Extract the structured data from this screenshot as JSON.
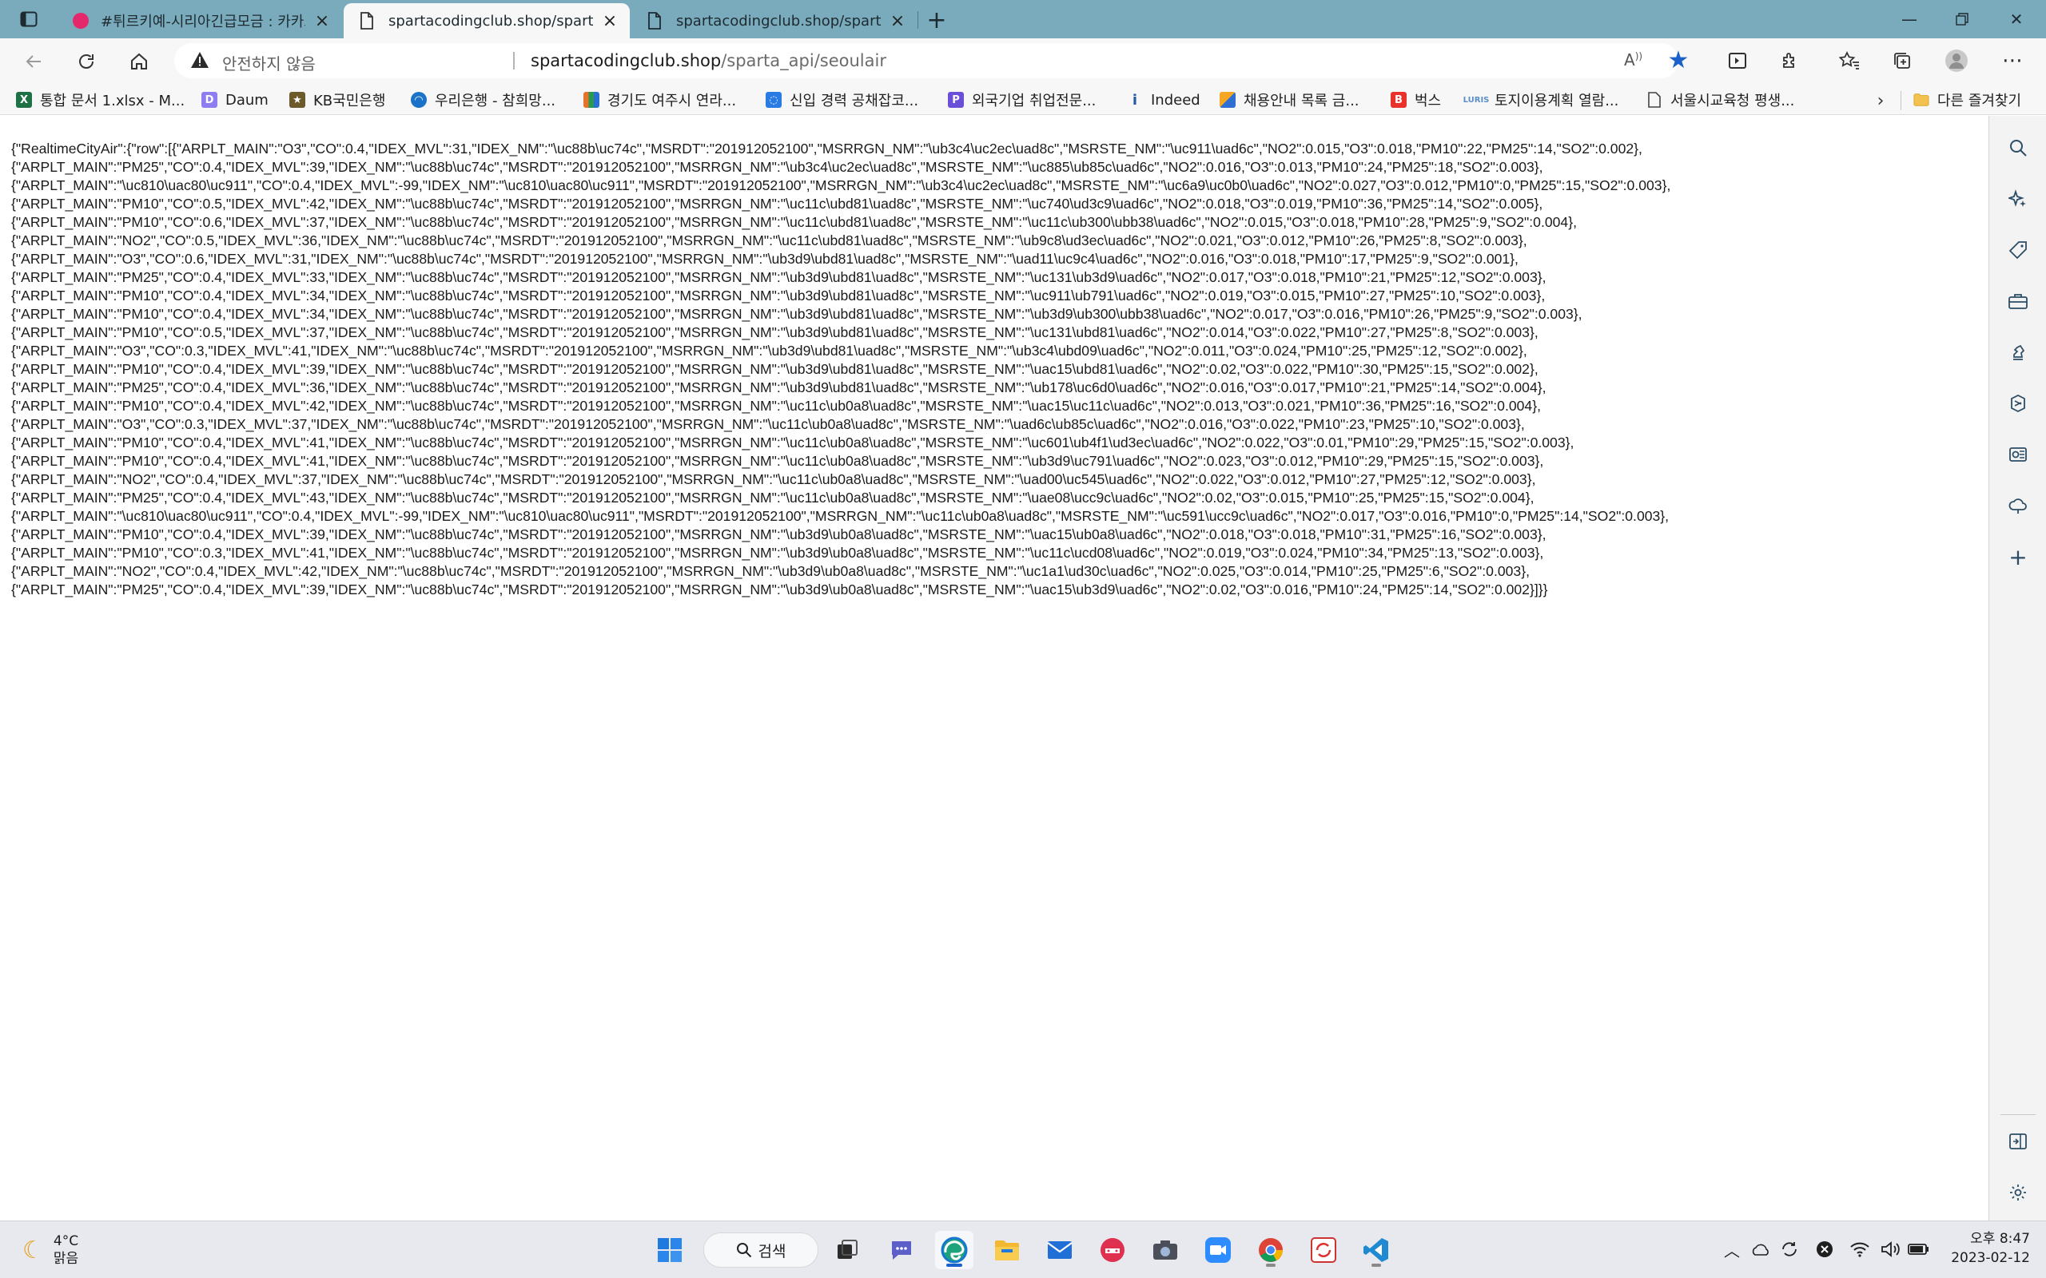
{
  "tabs": [
    {
      "title": "#튀르키예-시리아긴급모금 : 카카오",
      "active": false
    },
    {
      "title": "spartacodingclub.shop/sparta_api/seoulair",
      "active": true
    },
    {
      "title": "spartacodingclub.shop/sparta_api/seoulair",
      "active": false
    }
  ],
  "address": {
    "security_label": "안전하지 않음",
    "url_host": "spartacodingclub.shop",
    "url_path": "/sparta_api/seoulair"
  },
  "favorites": [
    {
      "label": "통합 문서 1.xlsx - M...",
      "icon": "excel-icon",
      "color": "#1e7145"
    },
    {
      "label": "Daum",
      "icon": "daum-icon",
      "color": "#7b68ee"
    },
    {
      "label": "KB국민은행",
      "icon": "kb-icon",
      "color": "#6d5a2b"
    },
    {
      "label": "우리은행 - 참희망...",
      "icon": "woori-icon",
      "color": "#1a72c9"
    },
    {
      "label": "경기도 여주시 연라...",
      "icon": "gyeonggi-icon",
      "color": "#e6732a"
    },
    {
      "label": "신입 경력 공채잡코...",
      "icon": "jobkorea-icon",
      "color": "#2b7be4"
    },
    {
      "label": "외국기업 취업전문...",
      "icon": "peoplenjob-icon",
      "color": "#6b4fd8"
    },
    {
      "label": "Indeed",
      "icon": "indeed-icon",
      "color": "#2557a7"
    },
    {
      "label": "채용안내 목록 금...",
      "icon": "recruit-icon",
      "color": "#2f6fd1"
    },
    {
      "label": "벅스",
      "icon": "bugs-icon",
      "color": "#e8322b"
    },
    {
      "label": "토지이용계획 열람...",
      "icon": "luris-icon",
      "color": "#5a8fc7"
    },
    {
      "label": "서울시교육청 평생...",
      "icon": "document-icon",
      "color": "#555555"
    }
  ],
  "favorites_other": "다른 즐겨찾기",
  "json_lines": [
    "{\"RealtimeCityAir\":{\"row\":[{\"ARPLT_MAIN\":\"O3\",\"CO\":0.4,\"IDEX_MVL\":31,\"IDEX_NM\":\"\\uc88b\\uc74c\",\"MSRDT\":\"201912052100\",\"MSRRGN_NM\":\"\\ub3c4\\uc2ec\\uad8c\",\"MSRSTE_NM\":\"\\uc911\\uad6c\",\"NO2\":0.015,\"O3\":0.018,\"PM10\":22,\"PM25\":14,\"SO2\":0.002},",
    "{\"ARPLT_MAIN\":\"PM25\",\"CO\":0.4,\"IDEX_MVL\":39,\"IDEX_NM\":\"\\uc88b\\uc74c\",\"MSRDT\":\"201912052100\",\"MSRRGN_NM\":\"\\ub3c4\\uc2ec\\uad8c\",\"MSRSTE_NM\":\"\\uc885\\ub85c\\uad6c\",\"NO2\":0.016,\"O3\":0.013,\"PM10\":24,\"PM25\":18,\"SO2\":0.003},",
    "{\"ARPLT_MAIN\":\"\\uc810\\uac80\\uc911\",\"CO\":0.4,\"IDEX_MVL\":-99,\"IDEX_NM\":\"\\uc810\\uac80\\uc911\",\"MSRDT\":\"201912052100\",\"MSRRGN_NM\":\"\\ub3c4\\uc2ec\\uad8c\",\"MSRSTE_NM\":\"\\uc6a9\\uc0b0\\uad6c\",\"NO2\":0.027,\"O3\":0.012,\"PM10\":0,\"PM25\":15,\"SO2\":0.003},",
    "{\"ARPLT_MAIN\":\"PM10\",\"CO\":0.5,\"IDEX_MVL\":42,\"IDEX_NM\":\"\\uc88b\\uc74c\",\"MSRDT\":\"201912052100\",\"MSRRGN_NM\":\"\\uc11c\\ubd81\\uad8c\",\"MSRSTE_NM\":\"\\uc740\\ud3c9\\uad6c\",\"NO2\":0.018,\"O3\":0.019,\"PM10\":36,\"PM25\":14,\"SO2\":0.005},",
    "{\"ARPLT_MAIN\":\"PM10\",\"CO\":0.6,\"IDEX_MVL\":37,\"IDEX_NM\":\"\\uc88b\\uc74c\",\"MSRDT\":\"201912052100\",\"MSRRGN_NM\":\"\\uc11c\\ubd81\\uad8c\",\"MSRSTE_NM\":\"\\uc11c\\ub300\\ubb38\\uad6c\",\"NO2\":0.015,\"O3\":0.018,\"PM10\":28,\"PM25\":9,\"SO2\":0.004},",
    "{\"ARPLT_MAIN\":\"NO2\",\"CO\":0.5,\"IDEX_MVL\":36,\"IDEX_NM\":\"\\uc88b\\uc74c\",\"MSRDT\":\"201912052100\",\"MSRRGN_NM\":\"\\uc11c\\ubd81\\uad8c\",\"MSRSTE_NM\":\"\\ub9c8\\ud3ec\\uad6c\",\"NO2\":0.021,\"O3\":0.012,\"PM10\":26,\"PM25\":8,\"SO2\":0.003},",
    "{\"ARPLT_MAIN\":\"O3\",\"CO\":0.6,\"IDEX_MVL\":31,\"IDEX_NM\":\"\\uc88b\\uc74c\",\"MSRDT\":\"201912052100\",\"MSRRGN_NM\":\"\\ub3d9\\ubd81\\uad8c\",\"MSRSTE_NM\":\"\\uad11\\uc9c4\\uad6c\",\"NO2\":0.016,\"O3\":0.018,\"PM10\":17,\"PM25\":9,\"SO2\":0.001},",
    "{\"ARPLT_MAIN\":\"PM25\",\"CO\":0.4,\"IDEX_MVL\":33,\"IDEX_NM\":\"\\uc88b\\uc74c\",\"MSRDT\":\"201912052100\",\"MSRRGN_NM\":\"\\ub3d9\\ubd81\\uad8c\",\"MSRSTE_NM\":\"\\uc131\\ub3d9\\uad6c\",\"NO2\":0.017,\"O3\":0.018,\"PM10\":21,\"PM25\":12,\"SO2\":0.003},",
    "{\"ARPLT_MAIN\":\"PM10\",\"CO\":0.4,\"IDEX_MVL\":34,\"IDEX_NM\":\"\\uc88b\\uc74c\",\"MSRDT\":\"201912052100\",\"MSRRGN_NM\":\"\\ub3d9\\ubd81\\uad8c\",\"MSRSTE_NM\":\"\\uc911\\ub791\\uad6c\",\"NO2\":0.019,\"O3\":0.015,\"PM10\":27,\"PM25\":10,\"SO2\":0.003},",
    "{\"ARPLT_MAIN\":\"PM10\",\"CO\":0.4,\"IDEX_MVL\":34,\"IDEX_NM\":\"\\uc88b\\uc74c\",\"MSRDT\":\"201912052100\",\"MSRRGN_NM\":\"\\ub3d9\\ubd81\\uad8c\",\"MSRSTE_NM\":\"\\ub3d9\\ub300\\ubb38\\uad6c\",\"NO2\":0.017,\"O3\":0.016,\"PM10\":26,\"PM25\":9,\"SO2\":0.003},",
    "{\"ARPLT_MAIN\":\"PM10\",\"CO\":0.5,\"IDEX_MVL\":37,\"IDEX_NM\":\"\\uc88b\\uc74c\",\"MSRDT\":\"201912052100\",\"MSRRGN_NM\":\"\\ub3d9\\ubd81\\uad8c\",\"MSRSTE_NM\":\"\\uc131\\ubd81\\uad6c\",\"NO2\":0.014,\"O3\":0.022,\"PM10\":27,\"PM25\":8,\"SO2\":0.003},",
    "{\"ARPLT_MAIN\":\"O3\",\"CO\":0.3,\"IDEX_MVL\":41,\"IDEX_NM\":\"\\uc88b\\uc74c\",\"MSRDT\":\"201912052100\",\"MSRRGN_NM\":\"\\ub3d9\\ubd81\\uad8c\",\"MSRSTE_NM\":\"\\ub3c4\\ubd09\\uad6c\",\"NO2\":0.011,\"O3\":0.024,\"PM10\":25,\"PM25\":12,\"SO2\":0.002},",
    "{\"ARPLT_MAIN\":\"PM10\",\"CO\":0.4,\"IDEX_MVL\":39,\"IDEX_NM\":\"\\uc88b\\uc74c\",\"MSRDT\":\"201912052100\",\"MSRRGN_NM\":\"\\ub3d9\\ubd81\\uad8c\",\"MSRSTE_NM\":\"\\uac15\\ubd81\\uad6c\",\"NO2\":0.02,\"O3\":0.022,\"PM10\":30,\"PM25\":15,\"SO2\":0.002},",
    "{\"ARPLT_MAIN\":\"PM25\",\"CO\":0.4,\"IDEX_MVL\":36,\"IDEX_NM\":\"\\uc88b\\uc74c\",\"MSRDT\":\"201912052100\",\"MSRRGN_NM\":\"\\ub3d9\\ubd81\\uad8c\",\"MSRSTE_NM\":\"\\ub178\\uc6d0\\uad6c\",\"NO2\":0.016,\"O3\":0.017,\"PM10\":21,\"PM25\":14,\"SO2\":0.004},",
    "{\"ARPLT_MAIN\":\"PM10\",\"CO\":0.4,\"IDEX_MVL\":42,\"IDEX_NM\":\"\\uc88b\\uc74c\",\"MSRDT\":\"201912052100\",\"MSRRGN_NM\":\"\\uc11c\\ub0a8\\uad8c\",\"MSRSTE_NM\":\"\\uac15\\uc11c\\uad6c\",\"NO2\":0.013,\"O3\":0.021,\"PM10\":36,\"PM25\":16,\"SO2\":0.004},",
    "{\"ARPLT_MAIN\":\"O3\",\"CO\":0.3,\"IDEX_MVL\":37,\"IDEX_NM\":\"\\uc88b\\uc74c\",\"MSRDT\":\"201912052100\",\"MSRRGN_NM\":\"\\uc11c\\ub0a8\\uad8c\",\"MSRSTE_NM\":\"\\uad6c\\ub85c\\uad6c\",\"NO2\":0.016,\"O3\":0.022,\"PM10\":23,\"PM25\":10,\"SO2\":0.003},",
    "{\"ARPLT_MAIN\":\"PM10\",\"CO\":0.4,\"IDEX_MVL\":41,\"IDEX_NM\":\"\\uc88b\\uc74c\",\"MSRDT\":\"201912052100\",\"MSRRGN_NM\":\"\\uc11c\\ub0a8\\uad8c\",\"MSRSTE_NM\":\"\\uc601\\ub4f1\\ud3ec\\uad6c\",\"NO2\":0.022,\"O3\":0.01,\"PM10\":29,\"PM25\":15,\"SO2\":0.003},",
    "{\"ARPLT_MAIN\":\"PM10\",\"CO\":0.4,\"IDEX_MVL\":41,\"IDEX_NM\":\"\\uc88b\\uc74c\",\"MSRDT\":\"201912052100\",\"MSRRGN_NM\":\"\\uc11c\\ub0a8\\uad8c\",\"MSRSTE_NM\":\"\\ub3d9\\uc791\\uad6c\",\"NO2\":0.023,\"O3\":0.012,\"PM10\":29,\"PM25\":15,\"SO2\":0.003},",
    "{\"ARPLT_MAIN\":\"NO2\",\"CO\":0.4,\"IDEX_MVL\":37,\"IDEX_NM\":\"\\uc88b\\uc74c\",\"MSRDT\":\"201912052100\",\"MSRRGN_NM\":\"\\uc11c\\ub0a8\\uad8c\",\"MSRSTE_NM\":\"\\uad00\\uc545\\uad6c\",\"NO2\":0.022,\"O3\":0.012,\"PM10\":27,\"PM25\":12,\"SO2\":0.003},",
    "{\"ARPLT_MAIN\":\"PM25\",\"CO\":0.4,\"IDEX_MVL\":43,\"IDEX_NM\":\"\\uc88b\\uc74c\",\"MSRDT\":\"201912052100\",\"MSRRGN_NM\":\"\\uc11c\\ub0a8\\uad8c\",\"MSRSTE_NM\":\"\\uae08\\ucc9c\\uad6c\",\"NO2\":0.02,\"O3\":0.015,\"PM10\":25,\"PM25\":15,\"SO2\":0.004},",
    "{\"ARPLT_MAIN\":\"\\uc810\\uac80\\uc911\",\"CO\":0.4,\"IDEX_MVL\":-99,\"IDEX_NM\":\"\\uc810\\uac80\\uc911\",\"MSRDT\":\"201912052100\",\"MSRRGN_NM\":\"\\uc11c\\ub0a8\\uad8c\",\"MSRSTE_NM\":\"\\uc591\\ucc9c\\uad6c\",\"NO2\":0.017,\"O3\":0.016,\"PM10\":0,\"PM25\":14,\"SO2\":0.003},",
    "{\"ARPLT_MAIN\":\"PM10\",\"CO\":0.4,\"IDEX_MVL\":39,\"IDEX_NM\":\"\\uc88b\\uc74c\",\"MSRDT\":\"201912052100\",\"MSRRGN_NM\":\"\\ub3d9\\ub0a8\\uad8c\",\"MSRSTE_NM\":\"\\uac15\\ub0a8\\uad6c\",\"NO2\":0.018,\"O3\":0.018,\"PM10\":31,\"PM25\":16,\"SO2\":0.003},",
    "{\"ARPLT_MAIN\":\"PM10\",\"CO\":0.3,\"IDEX_MVL\":41,\"IDEX_NM\":\"\\uc88b\\uc74c\",\"MSRDT\":\"201912052100\",\"MSRRGN_NM\":\"\\ub3d9\\ub0a8\\uad8c\",\"MSRSTE_NM\":\"\\uc11c\\ucd08\\uad6c\",\"NO2\":0.019,\"O3\":0.024,\"PM10\":34,\"PM25\":13,\"SO2\":0.003},",
    "{\"ARPLT_MAIN\":\"NO2\",\"CO\":0.4,\"IDEX_MVL\":42,\"IDEX_NM\":\"\\uc88b\\uc74c\",\"MSRDT\":\"201912052100\",\"MSRRGN_NM\":\"\\ub3d9\\ub0a8\\uad8c\",\"MSRSTE_NM\":\"\\uc1a1\\ud30c\\uad6c\",\"NO2\":0.025,\"O3\":0.014,\"PM10\":25,\"PM25\":6,\"SO2\":0.003},",
    "{\"ARPLT_MAIN\":\"PM25\",\"CO\":0.4,\"IDEX_MVL\":39,\"IDEX_NM\":\"\\uc88b\\uc74c\",\"MSRDT\":\"201912052100\",\"MSRRGN_NM\":\"\\ub3d9\\ub0a8\\uad8c\",\"MSRSTE_NM\":\"\\uac15\\ub3d9\\uad6c\",\"NO2\":0.02,\"O3\":0.016,\"PM10\":24,\"PM25\":14,\"SO2\":0.002}]}}"
  ],
  "taskbar": {
    "weather_temp": "4°C",
    "weather_desc": "맑음",
    "search_label": "검색",
    "time": "오후 8:47",
    "date": "2023-02-12"
  }
}
